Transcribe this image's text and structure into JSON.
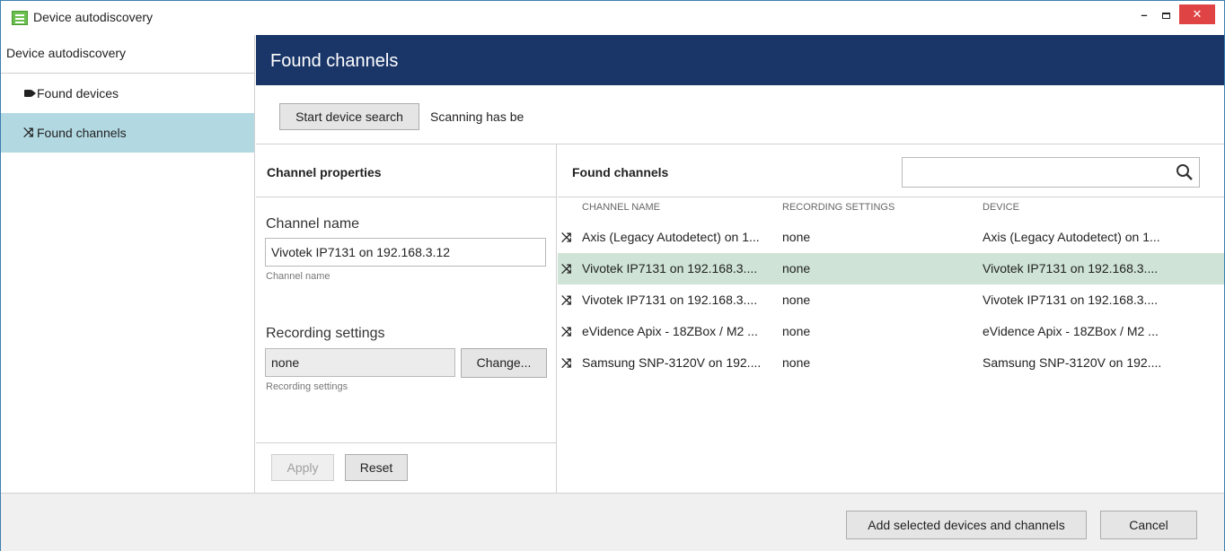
{
  "window": {
    "title": "Device autodiscovery",
    "controls": {
      "minimize": "–",
      "maximize": "□",
      "close": "✕"
    }
  },
  "sidebar": {
    "header": "Device autodiscovery",
    "items": [
      {
        "label": "Found devices",
        "icon": "camera-icon",
        "active": false
      },
      {
        "label": "Found channels",
        "icon": "shuffle-icon",
        "active": true
      }
    ]
  },
  "main": {
    "title": "Found channels",
    "toolbar": {
      "start_search_label": "Start device search",
      "status_text": "Scanning has be"
    }
  },
  "properties": {
    "title": "Channel properties",
    "channel_name": {
      "label": "Channel name",
      "value": "Vivotek IP7131 on 192.168.3.12",
      "hint": "Channel name"
    },
    "recording_settings": {
      "label": "Recording settings",
      "value": "none",
      "change_label": "Change...",
      "hint": "Recording settings"
    },
    "apply_label": "Apply",
    "reset_label": "Reset"
  },
  "channels": {
    "title": "Found channels",
    "search": {
      "value": "",
      "icon": "search-icon"
    },
    "columns": [
      "CHANNEL NAME",
      "RECORDING SETTINGS",
      "DEVICE"
    ],
    "rows": [
      {
        "name": "Axis (Legacy Autodetect) on 1...",
        "recording": "none",
        "device": "Axis (Legacy Autodetect) on 1...",
        "selected": false
      },
      {
        "name": "Vivotek IP7131 on 192.168.3....",
        "recording": "none",
        "device": "Vivotek IP7131 on 192.168.3....",
        "selected": true
      },
      {
        "name": "Vivotek IP7131 on 192.168.3....",
        "recording": "none",
        "device": "Vivotek IP7131 on 192.168.3....",
        "selected": false
      },
      {
        "name": "eVidence Apix - 18ZBox / M2 ...",
        "recording": "none",
        "device": "eVidence Apix - 18ZBox / M2 ...",
        "selected": false
      },
      {
        "name": "Samsung SNP-3120V on 192....",
        "recording": "none",
        "device": "Samsung SNP-3120V on 192....",
        "selected": false
      }
    ]
  },
  "footer": {
    "add_label": "Add selected devices and channels",
    "cancel_label": "Cancel"
  },
  "colors": {
    "header_bg": "#1a3669",
    "sidebar_active": "#b2d9e2",
    "row_selected": "#cfe4d6",
    "close_button": "#e04343"
  }
}
